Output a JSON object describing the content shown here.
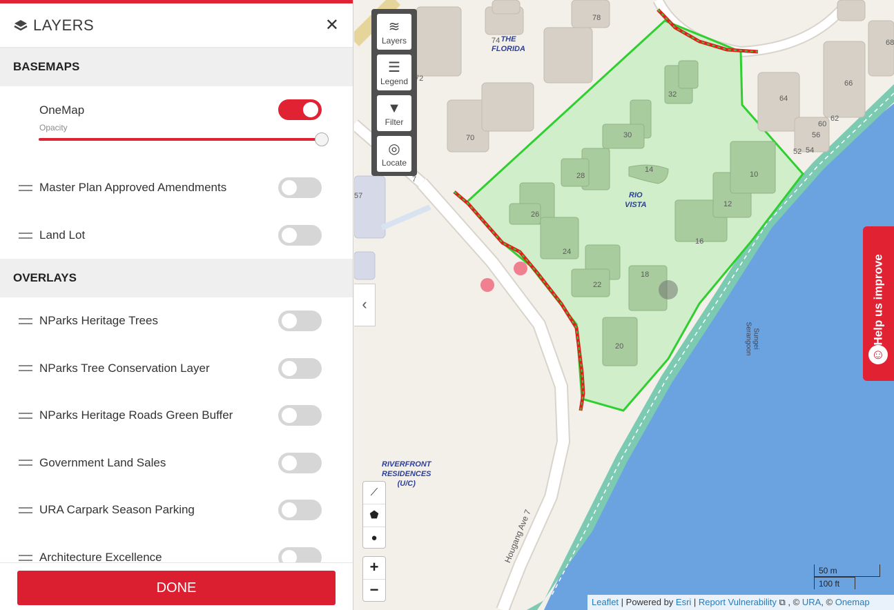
{
  "panel": {
    "title": "LAYERS",
    "sections": {
      "basemaps": "BASEMAPS",
      "overlays": "OVERLAYS"
    },
    "basemaps": [
      {
        "label": "OneMap",
        "sub": "Opacity",
        "on": true,
        "opacity": 1.0
      },
      {
        "label": "Master Plan Approved Amendments",
        "on": false
      },
      {
        "label": "Land Lot",
        "on": false
      }
    ],
    "overlays": [
      {
        "label": "NParks Heritage Trees",
        "on": false
      },
      {
        "label": "NParks Tree Conservation Layer",
        "on": false
      },
      {
        "label": "NParks Heritage Roads Green Buffer",
        "on": false
      },
      {
        "label": "Government Land Sales",
        "on": false
      },
      {
        "label": "URA Carpark Season Parking",
        "on": false
      },
      {
        "label": "Architecture Excellence",
        "on": false
      }
    ],
    "done": "DONE"
  },
  "map": {
    "tools": [
      "Layers",
      "Legend",
      "Filter",
      "Locate"
    ],
    "labels": {
      "the_florida": "THE\nFLORIDA",
      "rio_vista": "RIO\nVISTA",
      "riverfront": "RIVERFRONT\nRESIDENCES\n(U/C)",
      "road": "Hougang Ave 7",
      "river": "Sungei\nSerangoon",
      "numbers": [
        "78",
        "74",
        "72",
        "70",
        "57",
        "68",
        "66",
        "64",
        "62",
        "60",
        "56",
        "54",
        "52",
        "32",
        "30",
        "28",
        "26",
        "24",
        "22",
        "20",
        "18",
        "16",
        "14",
        "12",
        "10",
        "7"
      ]
    },
    "help": "Help us improve",
    "scale": {
      "metric": "50 m",
      "imperial": "100 ft"
    },
    "attribution": {
      "leaflet": "Leaflet",
      "powered": " | Powered by ",
      "esri": "Esri",
      "sep": " | ",
      "report": "Report Vulnerability",
      "ura_prefix": " , © ",
      "ura": "URA",
      "onemap_prefix": ", © ",
      "onemap": "Onemap"
    },
    "colors": {
      "accent": "#e02233",
      "site": "#cfeec9",
      "river": "#6aa3e0"
    }
  }
}
